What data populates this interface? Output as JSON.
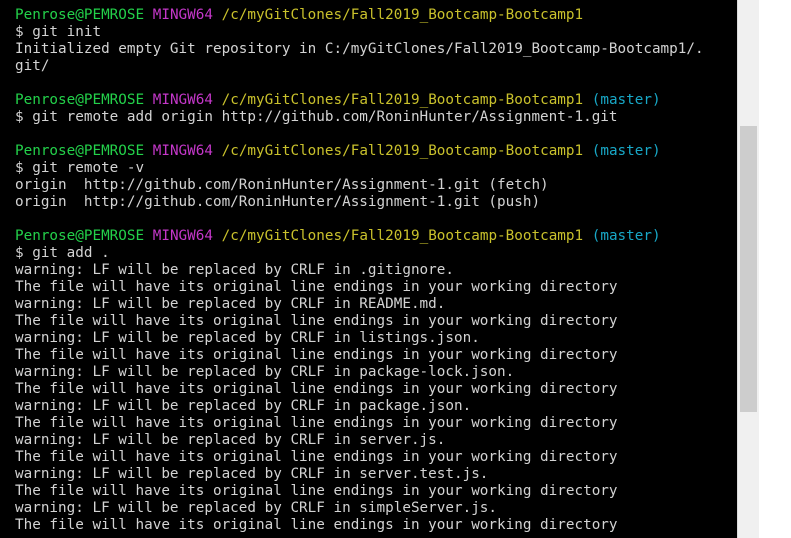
{
  "colors": {
    "user_host": "#23d14a",
    "mingw": "#c437c9",
    "path": "#c9c12c",
    "branch": "#18a8c7",
    "text": "#d3d3d3",
    "background": "#000000"
  },
  "terminal": {
    "lines": [
      {
        "type": "prompt",
        "user": "Penrose@PEMROSE",
        "shell": "MINGW64",
        "path": "/c/myGitClones/Fall2019_Bootcamp-Bootcamp1",
        "branch": ""
      },
      {
        "type": "text",
        "text": "$ git init"
      },
      {
        "type": "text",
        "text": "Initialized empty Git repository in C:/myGitClones/Fall2019_Bootcamp-Bootcamp1/."
      },
      {
        "type": "text",
        "text": "git/"
      },
      {
        "type": "text",
        "text": ""
      },
      {
        "type": "prompt",
        "user": "Penrose@PEMROSE",
        "shell": "MINGW64",
        "path": "/c/myGitClones/Fall2019_Bootcamp-Bootcamp1",
        "branch": "(master)"
      },
      {
        "type": "text",
        "text": "$ git remote add origin http://github.com/RoninHunter/Assignment-1.git"
      },
      {
        "type": "text",
        "text": ""
      },
      {
        "type": "prompt",
        "user": "Penrose@PEMROSE",
        "shell": "MINGW64",
        "path": "/c/myGitClones/Fall2019_Bootcamp-Bootcamp1",
        "branch": "(master)"
      },
      {
        "type": "text",
        "text": "$ git remote -v"
      },
      {
        "type": "text",
        "text": "origin  http://github.com/RoninHunter/Assignment-1.git (fetch)"
      },
      {
        "type": "text",
        "text": "origin  http://github.com/RoninHunter/Assignment-1.git (push)"
      },
      {
        "type": "text",
        "text": ""
      },
      {
        "type": "prompt",
        "user": "Penrose@PEMROSE",
        "shell": "MINGW64",
        "path": "/c/myGitClones/Fall2019_Bootcamp-Bootcamp1",
        "branch": "(master)"
      },
      {
        "type": "text",
        "text": "$ git add ."
      },
      {
        "type": "text",
        "text": "warning: LF will be replaced by CRLF in .gitignore."
      },
      {
        "type": "text",
        "text": "The file will have its original line endings in your working directory"
      },
      {
        "type": "text",
        "text": "warning: LF will be replaced by CRLF in README.md."
      },
      {
        "type": "text",
        "text": "The file will have its original line endings in your working directory"
      },
      {
        "type": "text",
        "text": "warning: LF will be replaced by CRLF in listings.json."
      },
      {
        "type": "text",
        "text": "The file will have its original line endings in your working directory"
      },
      {
        "type": "text",
        "text": "warning: LF will be replaced by CRLF in package-lock.json."
      },
      {
        "type": "text",
        "text": "The file will have its original line endings in your working directory"
      },
      {
        "type": "text",
        "text": "warning: LF will be replaced by CRLF in package.json."
      },
      {
        "type": "text",
        "text": "The file will have its original line endings in your working directory"
      },
      {
        "type": "text",
        "text": "warning: LF will be replaced by CRLF in server.js."
      },
      {
        "type": "text",
        "text": "The file will have its original line endings in your working directory"
      },
      {
        "type": "text",
        "text": "warning: LF will be replaced by CRLF in server.test.js."
      },
      {
        "type": "text",
        "text": "The file will have its original line endings in your working directory"
      },
      {
        "type": "text",
        "text": "warning: LF will be replaced by CRLF in simpleServer.js."
      },
      {
        "type": "text",
        "text": "The file will have its original line endings in your working directory"
      }
    ]
  }
}
